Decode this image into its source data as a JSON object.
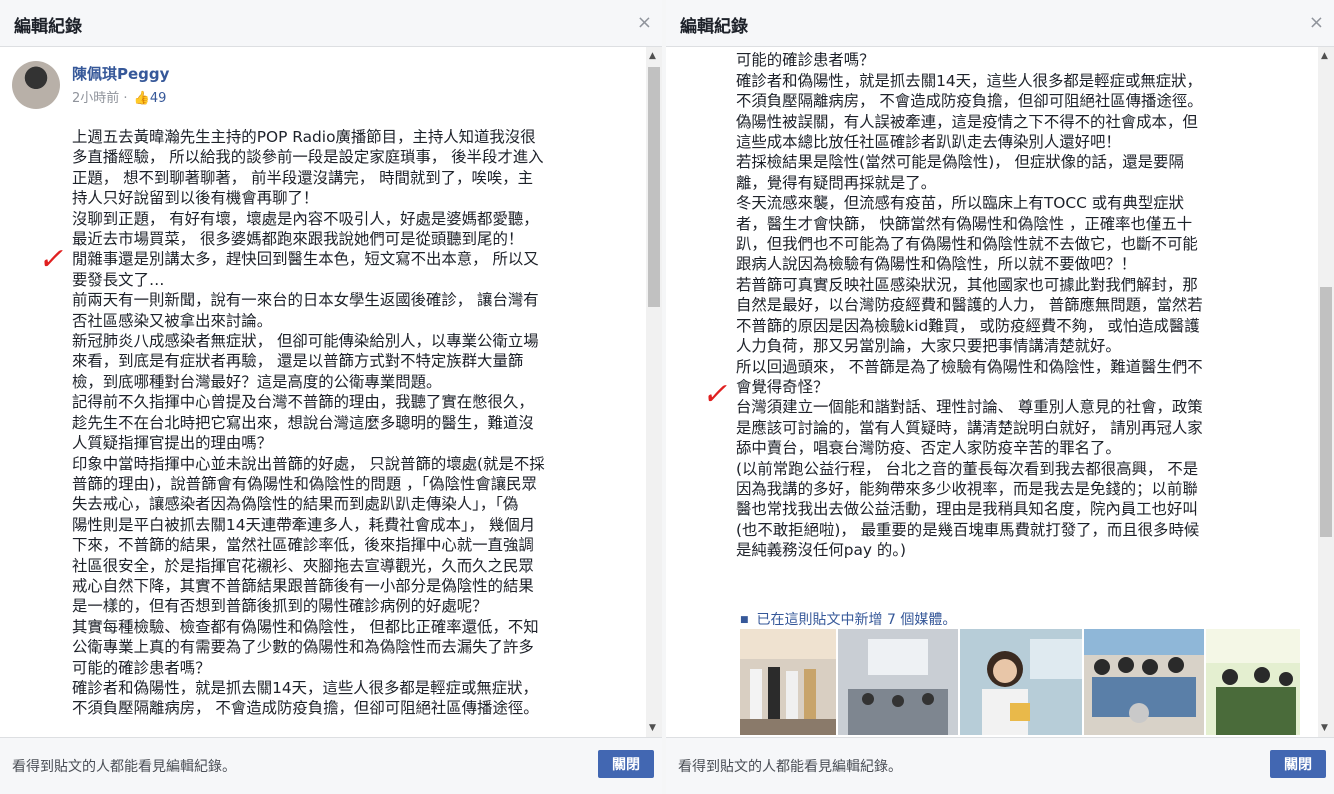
{
  "dialog_title": "編輯紀錄",
  "close_symbol": "×",
  "footer_note": "看得到貼文的人都能看見編輯紀錄。",
  "close_button": "關閉",
  "author": "陳佩琪Peggy",
  "time": "2小時前 · ",
  "likes": "49",
  "left_lines": [
    "上週五去黃暐瀚先生主持的POP Radio廣播節目，主持人知道我沒很",
    "多直播經驗， 所以給我的談參前一段是設定家庭瑣事， 後半段才進入",
    "正題， 想不到聊著聊著， 前半段還沒講完， 時間就到了，唉唉，主",
    "持人只好說留到以後有機會再聊了！",
    "沒聊到正題， 有好有壞，壞處是內容不吸引人，好處是婆媽都愛聽，",
    "最近去市場買菜， 很多婆媽都跑來跟我說她們可是從頭聽到尾的！",
    "閒雜事還是別講太多，趕快回到醫生本色，短文寫不出本意， 所以又",
    "要發長文了…",
    "前兩天有一則新聞，說有一來台的日本女學生返國後確診， 讓台灣有",
    "否社區感染又被拿出來討論。",
    "新冠肺炎八成感染者無症狀， 但卻可能傳染給別人，以專業公衛立場",
    "來看，到底是有症狀者再驗， 還是以普篩方式對不特定族群大量篩",
    "檢，到底哪種對台灣最好？這是高度的公衛專業問題。",
    "記得前不久指揮中心曾提及台灣不普篩的理由，我聽了實在憋很久，",
    "趁先生不在台北時把它寫出來，想說台灣這麼多聰明的醫生，難道沒",
    "人質疑指揮官提出的理由嗎？",
    "印象中當時指揮中心並未說出普篩的好處， 只說普篩的壞處(就是不採",
    "普篩的理由)，說普篩會有偽陽性和偽陰性的問題 ，「偽陰性會讓民眾",
    "失去戒心，讓感染者因為偽陰性的結果而到處趴趴走傳染人」，「偽",
    "陽性則是平白被抓去關14天連帶牽連多人，耗費社會成本」， 幾個月",
    "下來，不普篩的結果，當然社區確診率低，後來指揮中心就一直強調",
    "社區很安全，於是指揮官花襯衫、夾腳拖去宣導觀光，久而久之民眾",
    "戒心自然下降，其實不普篩結果跟普篩後有一小部分是偽陰性的結果",
    "是一樣的，但有否想到普篩後抓到的陽性確診病例的好處呢？",
    "其實每種檢驗、檢查都有偽陽性和偽陰性， 但都比正確率還低，不知",
    "公衛專業上真的有需要為了少數的偽陽性和為偽陰性而去漏失了許多",
    "可能的確診患者嗎？",
    "確診者和偽陽性，就是抓去關14天，這些人很多都是輕症或無症狀，",
    "不須負壓隔離病房， 不會造成防疫負擔，但卻可阻絕社區傳播途徑。"
  ],
  "right_lines": [
    "公衛專業上真的有需要為了少數的偽陽性和為偽陰性而去漏失了許多",
    "可能的確診患者嗎？",
    "確診者和偽陽性，就是抓去關14天，這些人很多都是輕症或無症狀，",
    "不須負壓隔離病房， 不會造成防疫負擔，但卻可阻絕社區傳播途徑。",
    "偽陽性被誤關，有人誤被牽連，這是疫情之下不得不的社會成本，但",
    "這些成本總比放任社區確診者趴趴走去傳染別人還好吧！",
    "若採檢結果是陰性(當然可能是偽陰性)， 但症狀像的話，還是要隔",
    "離，覺得有疑問再採就是了。",
    "冬天流感來襲，但流感有疫苗，所以臨床上有TOCC 或有典型症狀",
    "者，醫生才會快篩， 快篩當然有偽陽性和偽陰性 ，正確率也僅五十",
    "趴，但我們也不可能為了有偽陽性和偽陰性就不去做它，也斷不可能",
    "跟病人說因為檢驗有偽陽性和偽陰性，所以就不要做吧？！",
    "若普篩可真實反映社區感染狀況，其他國家也可據此對我們解封，那",
    "自然是最好，以台灣防疫經費和醫護的人力， 普篩應無問題，當然若",
    "不普篩的原因是因為檢驗kid難買， 或防疫經費不夠， 或怕造成醫護",
    "人力負荷，那又另當別論，大家只要把事情講清楚就好。",
    "所以回過頭來， 不普篩是為了檢驗有偽陽性和偽陰性，難道醫生們不",
    "會覺得奇怪？",
    "台灣須建立一個能和諧對話、理性討論、 尊重別人意見的社會，政策",
    "是應該可討論的，當有人質疑時，講清楚說明白就好， 請別再冠人家",
    "舔中賣台，唱衰台灣防疫、否定人家防疫辛苦的罪名了。",
    "(以前常跑公益行程， 台北之音的董長每次看到我去都很高興， 不是",
    "因為我講的多好，能夠帶來多少收視率，而是我去是免錢的；以前聯",
    "醫也常找我出去做公益活動，理由是我稍具知名度，院內員工也好叫",
    "(也不敢拒絕啦)， 最重要的是幾百塊車馬費就打發了，而且很多時候",
    "是純義務沒任何pay 的。)"
  ],
  "media_note": "已在這則貼文中新增 7 個媒體。",
  "thumbnail_names": [
    "award-ceremony-photo",
    "seminar-room-photo",
    "speaker-woman-photo",
    "group-elderly-photo",
    "event-banner-photo"
  ]
}
